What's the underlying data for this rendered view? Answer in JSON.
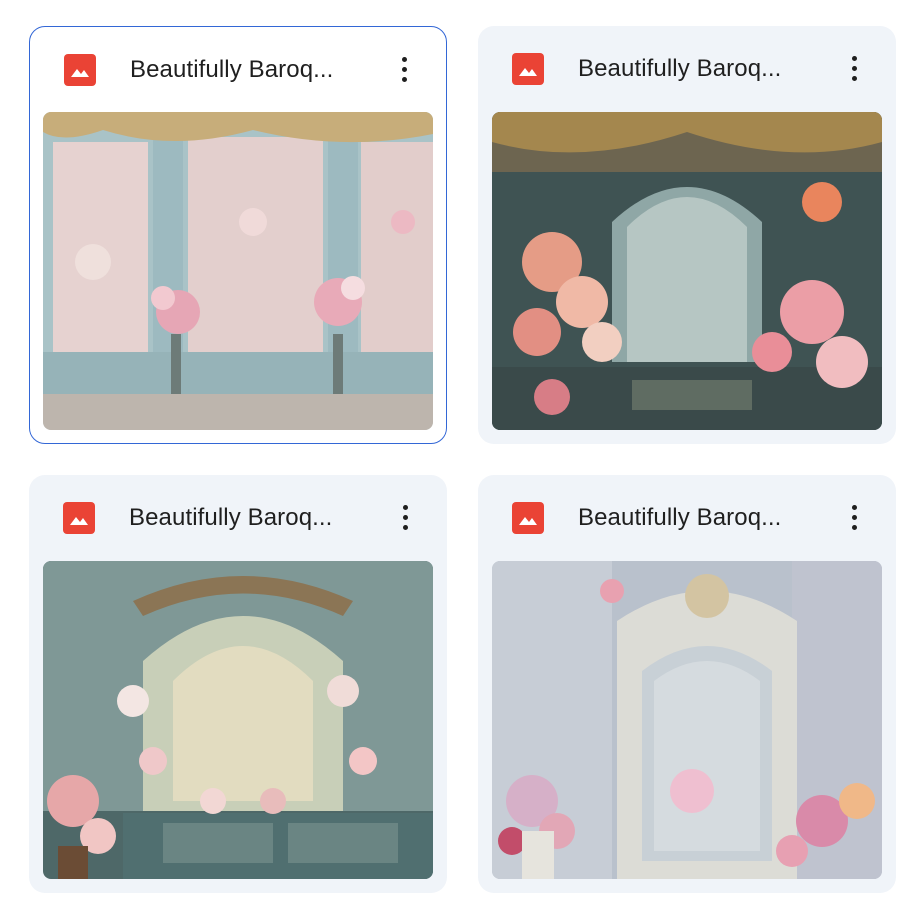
{
  "files": [
    {
      "name": "Beautifully Baroq...",
      "type_icon": "image-file-icon",
      "selected": true,
      "thumbnail": "baroque-blue-panel-wall-with-pink-floral-vases"
    },
    {
      "name": "Beautifully Baroq...",
      "type_icon": "image-file-icon",
      "selected": false,
      "thumbnail": "baroque-arch-with-peach-floral-arrangements"
    },
    {
      "name": "Beautifully Baroq...",
      "type_icon": "image-file-icon",
      "selected": false,
      "thumbnail": "floral-arch-over-teal-wainscot"
    },
    {
      "name": "Beautifully Baroq...",
      "type_icon": "image-file-icon",
      "selected": false,
      "thumbnail": "ornate-white-door-panel-with-pink-flowers"
    }
  ],
  "colors": {
    "accent": "#3367d6",
    "icon_red": "#ea4335",
    "card_bg": "#f0f4f9"
  }
}
